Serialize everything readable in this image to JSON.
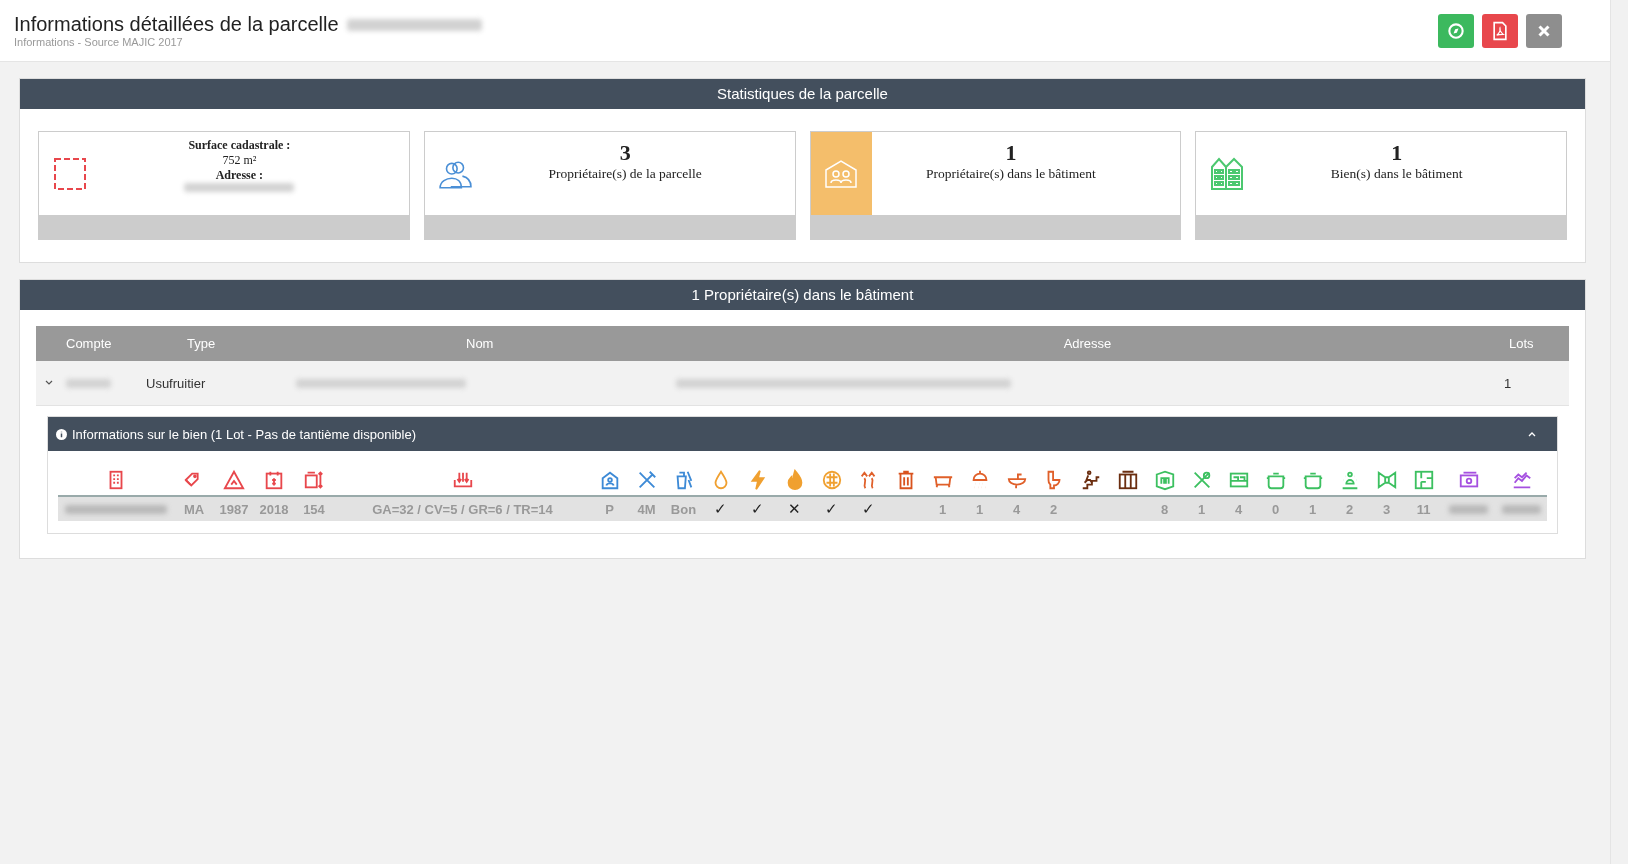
{
  "header": {
    "title": "Informations détaillées de la parcelle",
    "subtitle": "Informations - Source MAJIC 2017",
    "buttons": [
      {
        "kind": "compass",
        "color": "#3cb95e"
      },
      {
        "kind": "pdf",
        "color": "#e8474c"
      },
      {
        "kind": "close",
        "color": "#8e8e8e"
      }
    ]
  },
  "stats": {
    "title": "Statistiques de la parcelle",
    "cards": [
      {
        "kind": "parcel",
        "color": "#e8474c",
        "highlighted": false,
        "surface_label": "Surface cadastrale :",
        "surface": "752 m²",
        "address_label": "Adresse :"
      },
      {
        "kind": "owners",
        "color": "#4a8fd6",
        "highlighted": false,
        "count": "3",
        "label": "Propriétaire(s) de la parcelle"
      },
      {
        "kind": "building-owners",
        "color": "#f4be6b",
        "highlighted": true,
        "count": "1",
        "label": "Propriétaire(s) dans le bâtiment"
      },
      {
        "kind": "goods",
        "color": "#4cc870",
        "highlighted": false,
        "count": "1",
        "label": "Bien(s) dans le bâtiment"
      }
    ]
  },
  "owners": {
    "title": "1 Propriétaire(s) dans le bâtiment",
    "columns": [
      "Compte",
      "Type",
      "Nom",
      "Adresse",
      "Lots"
    ],
    "rows": [
      {
        "expanded": true,
        "type": "Usufruitier",
        "lots": "1",
        "detail": {
          "title": "Informations sur le bien (1 Lot - Pas de tantième disponible)",
          "expanded": true,
          "cells": [
            {
              "kind": "redacted",
              "color": "#e8474c"
            },
            {
              "kind": "value",
              "color": "#e8474c",
              "value": "MA"
            },
            {
              "kind": "value",
              "color": "#e8474c",
              "value": "1987"
            },
            {
              "kind": "value",
              "color": "#e8474c",
              "value": "2018"
            },
            {
              "kind": "value",
              "color": "#e8474c",
              "value": "154"
            },
            {
              "kind": "value",
              "color": "#e8474c",
              "value": "GA=32 / CV=5 / GR=6 / TR=14"
            },
            {
              "kind": "value",
              "color": "#3d8ad6",
              "value": "P"
            },
            {
              "kind": "value",
              "color": "#3d8ad6",
              "value": "4M"
            },
            {
              "kind": "value",
              "color": "#3d8ad6",
              "value": "Bon"
            },
            {
              "kind": "mark",
              "color": "#f0a030",
              "value": "✓"
            },
            {
              "kind": "mark",
              "color": "#f0a030",
              "value": "✓"
            },
            {
              "kind": "mark",
              "color": "#f0a030",
              "value": "✕"
            },
            {
              "kind": "mark",
              "color": "#f0a030",
              "value": "✓"
            },
            {
              "kind": "mark",
              "color": "#e0602a",
              "value": "✓"
            },
            {
              "kind": "blank",
              "color": "#d9531e"
            },
            {
              "kind": "value",
              "color": "#e0602a",
              "value": "1"
            },
            {
              "kind": "value",
              "color": "#e0602a",
              "value": "1"
            },
            {
              "kind": "value",
              "color": "#e0602a",
              "value": "4"
            },
            {
              "kind": "value",
              "color": "#e0602a",
              "value": "2"
            },
            {
              "kind": "blank",
              "color": "#6b2e10"
            },
            {
              "kind": "blank",
              "color": "#6b2e10"
            },
            {
              "kind": "value",
              "color": "#3cc060",
              "value": "8"
            },
            {
              "kind": "value",
              "color": "#3cc060",
              "value": "1"
            },
            {
              "kind": "value",
              "color": "#3cc060",
              "value": "4"
            },
            {
              "kind": "value",
              "color": "#3cc060",
              "value": "0"
            },
            {
              "kind": "value",
              "color": "#3cc060",
              "value": "1"
            },
            {
              "kind": "value",
              "color": "#3cc060",
              "value": "2"
            },
            {
              "kind": "value",
              "color": "#3cc060",
              "value": "3"
            },
            {
              "kind": "value",
              "color": "#3cc060",
              "value": "11"
            },
            {
              "kind": "redacted",
              "color": "#a550e0"
            },
            {
              "kind": "redacted",
              "color": "#a550e0"
            }
          ]
        }
      }
    ]
  }
}
